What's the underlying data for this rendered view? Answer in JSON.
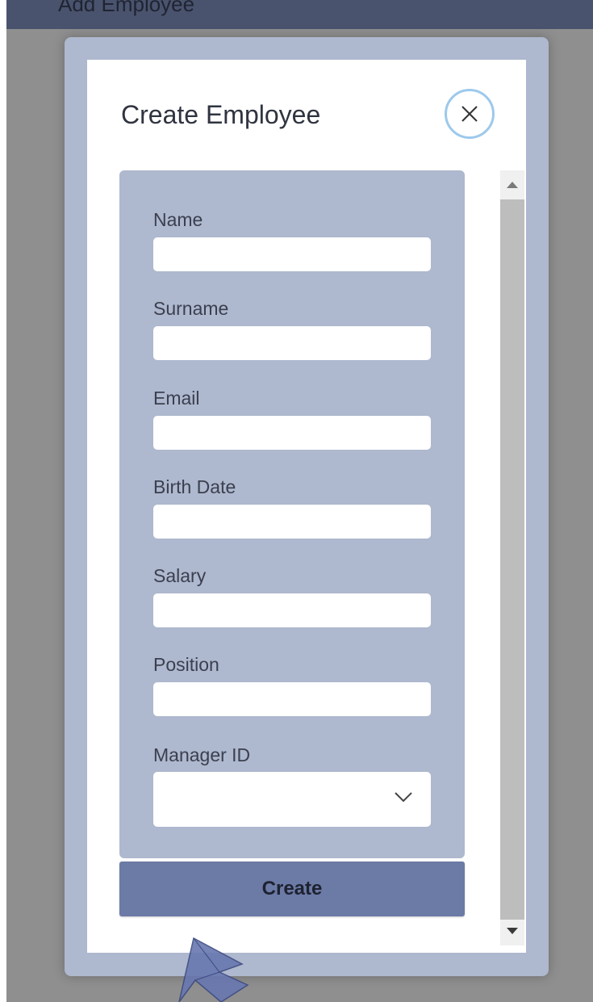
{
  "background_page": {
    "header_title": "Add Employee"
  },
  "modal": {
    "title": "Create Employee",
    "close_icon": "close-icon"
  },
  "form": {
    "fields": [
      {
        "label": "Name",
        "value": "",
        "placeholder": ""
      },
      {
        "label": "Surname",
        "value": "",
        "placeholder": ""
      },
      {
        "label": "Email",
        "value": "",
        "placeholder": ""
      },
      {
        "label": "Birth Date",
        "value": "",
        "placeholder": ""
      },
      {
        "label": "Salary",
        "value": "",
        "placeholder": ""
      },
      {
        "label": "Position",
        "value": "",
        "placeholder": ""
      }
    ],
    "manager": {
      "label": "Manager ID",
      "selected": "",
      "icon": "chevron-down-icon"
    },
    "submit_label": "Create"
  },
  "colors": {
    "accent": "#6c7aa6",
    "panel": "#aeb8ce",
    "close_ring": "#9dc9ec"
  }
}
